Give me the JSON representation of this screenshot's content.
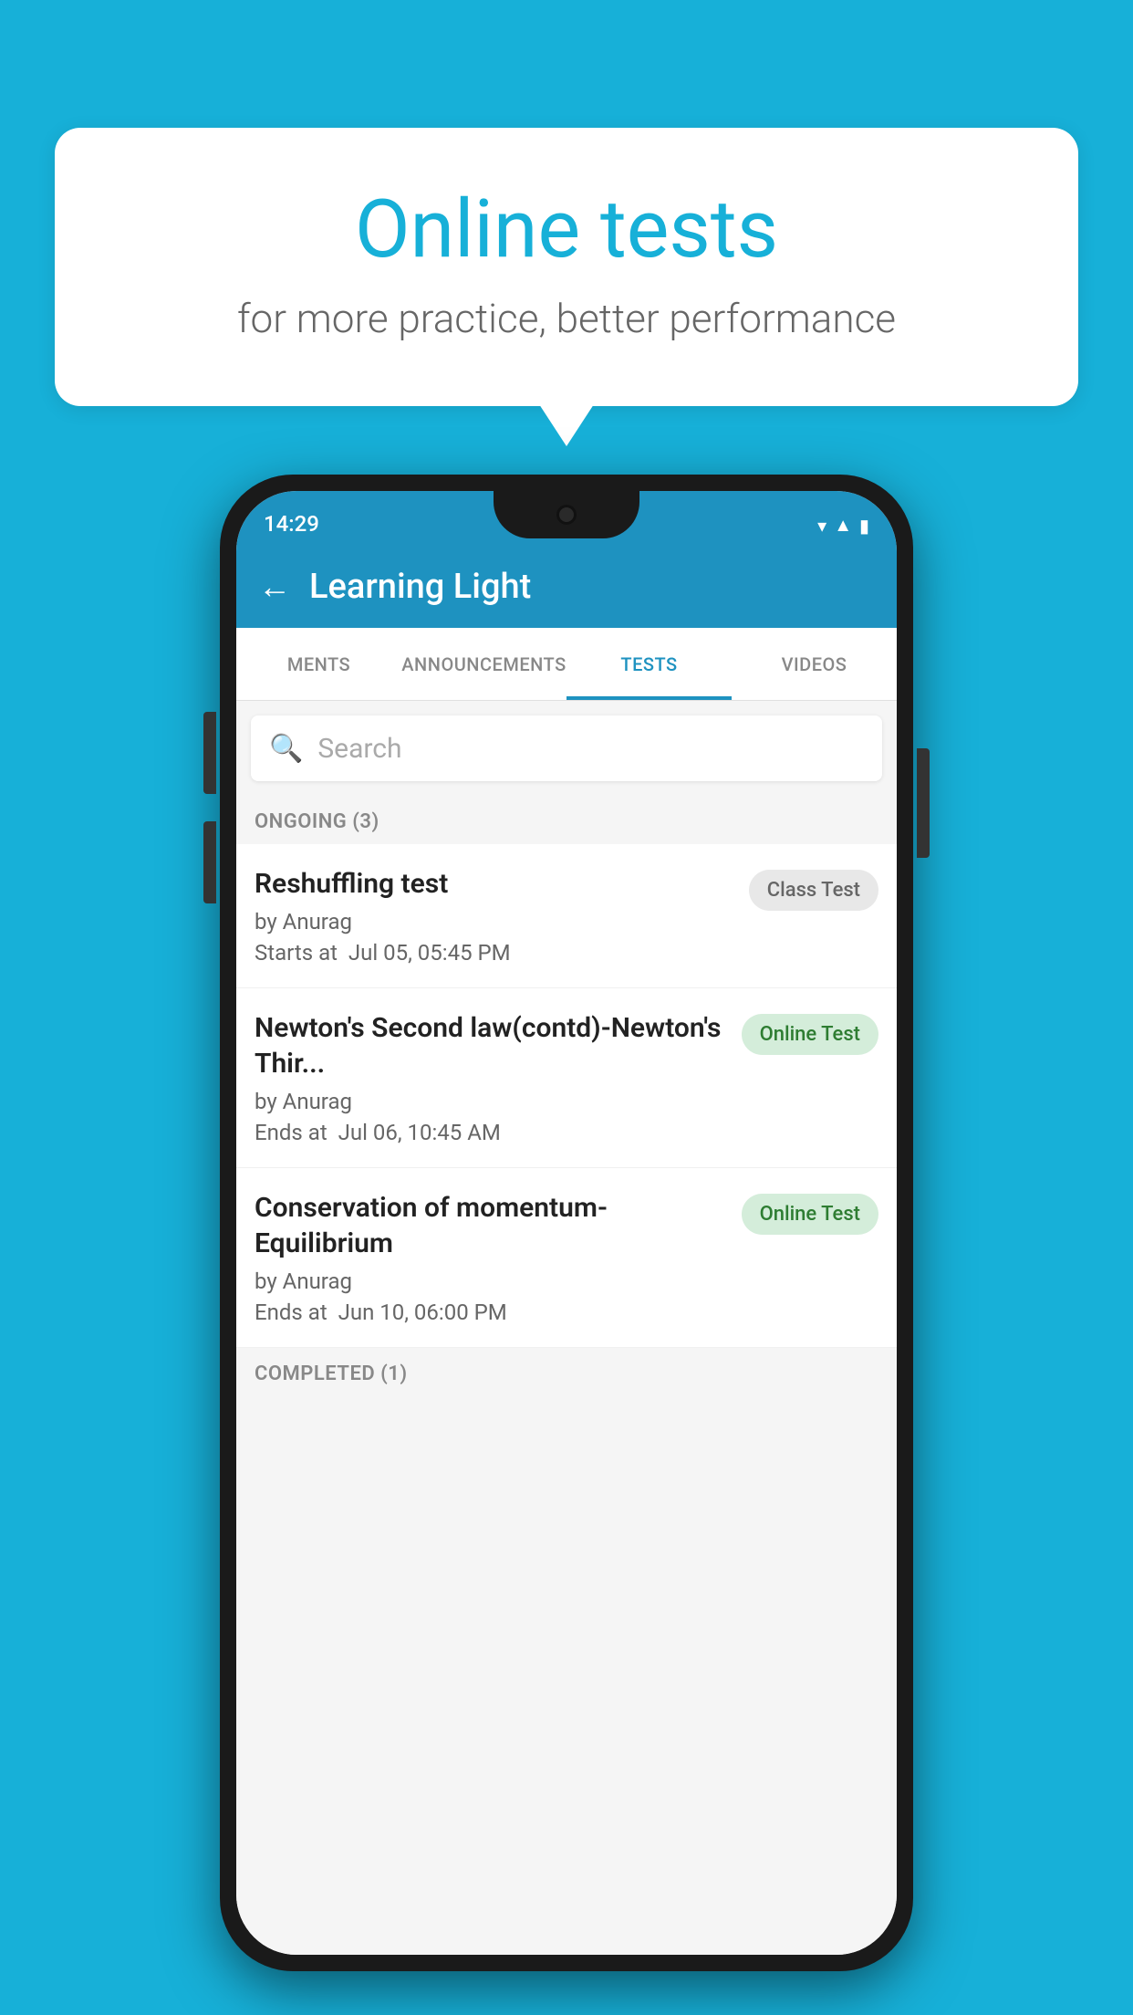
{
  "background_color": "#17b0d8",
  "speech_bubble": {
    "title": "Online tests",
    "subtitle": "for more practice, better performance"
  },
  "phone": {
    "status_bar": {
      "time": "14:29",
      "icons": [
        "wifi",
        "signal",
        "battery"
      ]
    },
    "app_bar": {
      "back_label": "←",
      "title": "Learning Light"
    },
    "tabs": [
      {
        "label": "MENTS",
        "active": false
      },
      {
        "label": "ANNOUNCEMENTS",
        "active": false
      },
      {
        "label": "TESTS",
        "active": true
      },
      {
        "label": "VIDEOS",
        "active": false
      }
    ],
    "search": {
      "placeholder": "Search"
    },
    "sections": [
      {
        "header": "ONGOING (3)",
        "tests": [
          {
            "name": "Reshuffling test",
            "author": "by Anurag",
            "date_label": "Starts at",
            "date": "Jul 05, 05:45 PM",
            "badge": "Class Test",
            "badge_type": "class"
          },
          {
            "name": "Newton's Second law(contd)-Newton's Thir...",
            "author": "by Anurag",
            "date_label": "Ends at",
            "date": "Jul 06, 10:45 AM",
            "badge": "Online Test",
            "badge_type": "online"
          },
          {
            "name": "Conservation of momentum-Equilibrium",
            "author": "by Anurag",
            "date_label": "Ends at",
            "date": "Jun 10, 06:00 PM",
            "badge": "Online Test",
            "badge_type": "online"
          }
        ]
      },
      {
        "header": "COMPLETED (1)",
        "tests": []
      }
    ]
  }
}
